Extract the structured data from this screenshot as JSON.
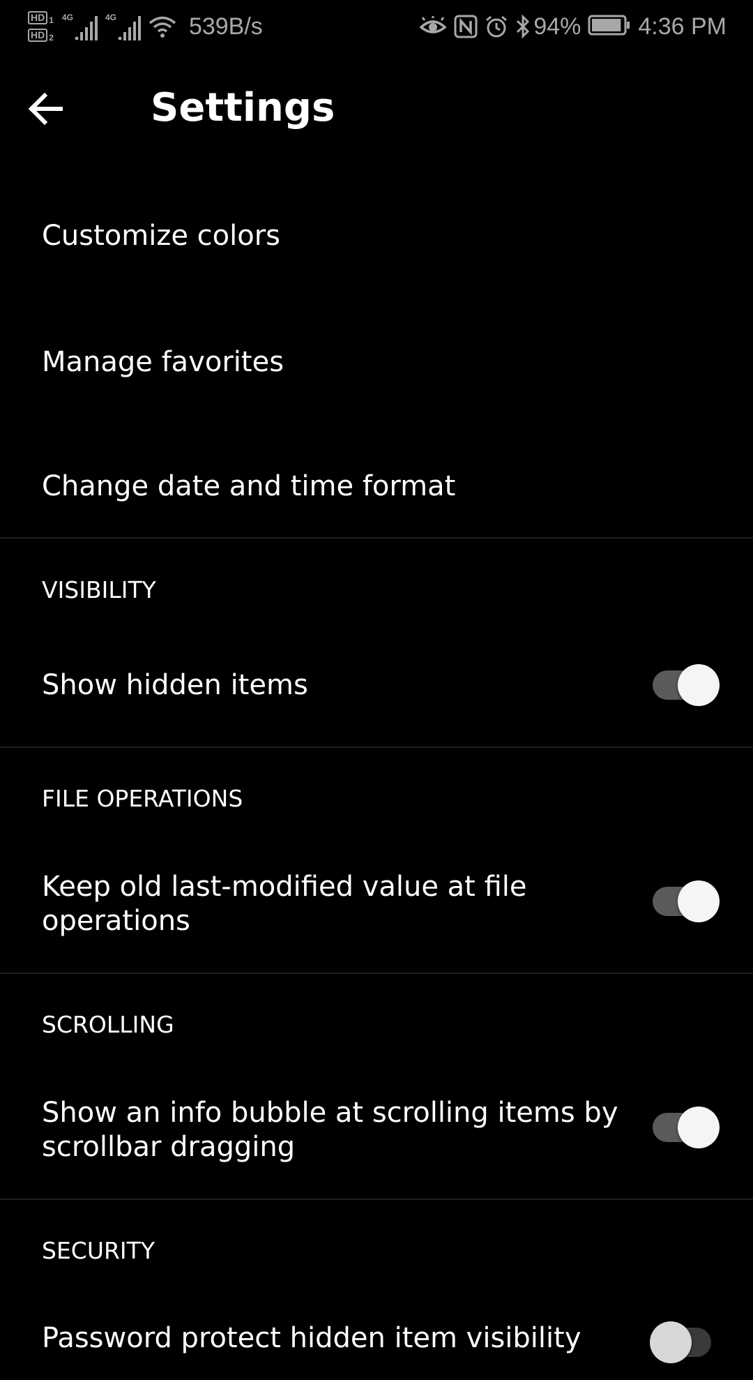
{
  "status_bar": {
    "sim_slots": [
      {
        "badge": "HD",
        "slot": "1",
        "network": "4G"
      },
      {
        "badge": "HD",
        "slot": "2",
        "network": "4G"
      }
    ],
    "net_speed": "539B/s",
    "icons": [
      "eye-comfort-icon",
      "nfc-icon",
      "alarm-icon",
      "bluetooth-icon",
      "wifi-icon",
      "battery-icon"
    ],
    "battery_percent": "94%",
    "battery_level": 0.94,
    "time": "4:36 PM"
  },
  "toolbar": {
    "back_icon": "arrow-back-icon",
    "title": "Settings"
  },
  "items": {
    "customize_colors": "Customize colors",
    "manage_favorites": "Manage favorites",
    "date_time_format": "Change date and time format"
  },
  "sections": {
    "visibility": {
      "header": "VISIBILITY",
      "show_hidden": {
        "label": "Show hidden items",
        "enabled": true
      }
    },
    "file_operations": {
      "header": "FILE OPERATIONS",
      "keep_modified": {
        "label_line1": "Keep old last-modified value at file",
        "label_line2": "operations",
        "enabled": true
      }
    },
    "scrolling": {
      "header": "SCROLLING",
      "info_bubble": {
        "label_line1": "Show an info bubble at scrolling items by",
        "label_line2": "scrollbar dragging",
        "enabled": true
      }
    },
    "security": {
      "header": "SECURITY",
      "next_item": {
        "label": "Password protect hidden item visibility",
        "enabled": false
      }
    }
  },
  "colors": {
    "background": "#000000",
    "text": "#ffffff",
    "status_text": "#a8a8a8",
    "switch_track": "#5a5a5a",
    "switch_thumb": "#f5f5f5",
    "divider": "#1f1f1f"
  }
}
